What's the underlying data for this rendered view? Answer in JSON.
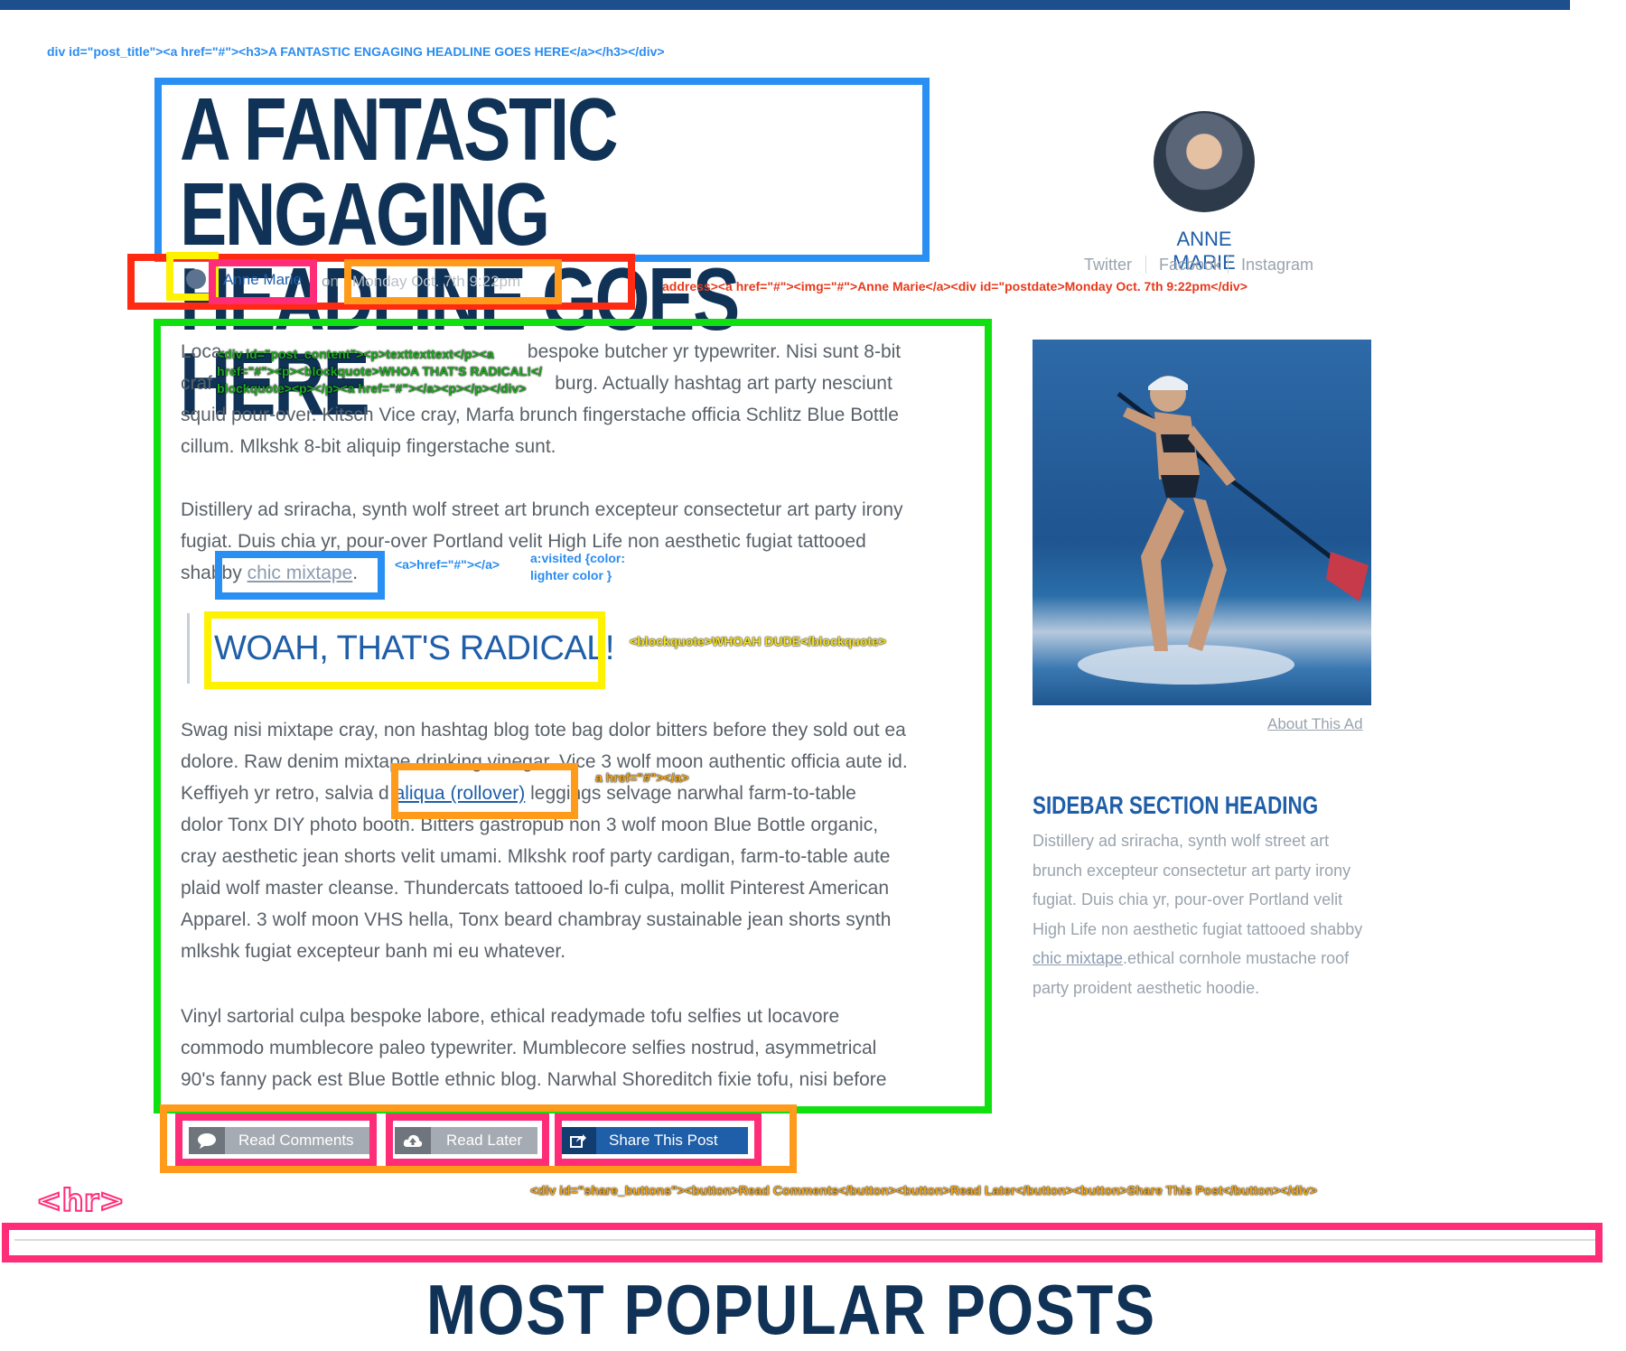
{
  "annotations": {
    "post_title_code": "div id=\"post_title\"><a href=\"#\"><h3>A FANTASTIC ENGAGING HEADLINE GOES HERE</a></h3></div>",
    "address_code": "address><a href=\"#\"><img=\"#\">Anne Marie</a><div id=\"postdate>Monday Oct. 7th 9:22pm</div>",
    "post_content_code_1": "<div id=\"post_content\"><p>texttexttext</p><a",
    "post_content_code_2": "href=\"#\"><p><blockquote>WHOA THAT'S RADICAL!</",
    "post_content_code_3": "blockquote><p></p><a href=\"#\"></a><p></p></div>",
    "anchor_code": "<a>href=\"#\"></a>",
    "visited_code_1": "a:visited {color:",
    "visited_code_2": "lighter color }",
    "blockquote_code": "<blockquote>WHOAH DUDE</blockquote>",
    "rollover_code": "a href=\"#\"></a>",
    "hr_label": "<hr>",
    "share_buttons_code": "<div id=\"share_buttons\"><button>Read Comments</button><button>Read Later</button><button>Share This Post</button></div>"
  },
  "post": {
    "headline_line1": "A FANTASTIC ENGAGING",
    "headline_line2": "HEADLINE GOES HERE",
    "author": "Anne Marie",
    "on": "on",
    "date": "Monday Oct. 7th 9:22pm",
    "p1_l1": "Loca                                                          bespoke butcher yr typewriter. Nisi sunt 8-bit",
    "p1_l2": "craf                                                                 burg. Actually hashtag art party nesciunt",
    "p1_l3": "squid pour-over. Kitsch Vice cray, Marfa brunch fingerstache officia Schlitz Blue Bottle",
    "p1_l4": "cillum. Mlkshk 8-bit aliquip fingerstache sunt.",
    "p2_l1": "Distillery ad sriracha, synth wolf street art brunch excepteur consectetur art party irony",
    "p2_l2": "fugiat. Duis chia yr, pour-over Portland velit High Life non aesthetic fugiat tattooed",
    "p2_pre": "shabby ",
    "p2_link": "chic mixtape",
    "p2_post": ".",
    "blockquote": "WOAH, THAT'S RADICAL!",
    "p3_l1": "Swag nisi mixtape cray, non hashtag blog tote bag dolor bitters before they sold out ea",
    "p3_l2": "dolore. Raw denim mixtape drinking vinegar, Vice 3 wolf moon authentic officia aute id.",
    "p3_pre": "Keffiyeh yr retro, salvia d ",
    "p3_link": "aliqua (rollover)",
    "p3_post": " leggings selvage narwhal farm-to-table",
    "p3_l4": "dolor Tonx DIY photo booth. Bitters gastropub non 3 wolf moon Blue Bottle organic,",
    "p3_l5": "cray aesthetic jean shorts velit umami. Mlkshk roof party cardigan, farm-to-table aute",
    "p3_l6": "plaid wolf master cleanse. Thundercats tattooed lo-fi culpa, mollit Pinterest American",
    "p3_l7": "Apparel. 3 wolf moon VHS hella, Tonx beard chambray sustainable jean shorts synth",
    "p3_l8": "mlkshk fugiat excepteur banh mi eu whatever.",
    "p4_l1": "Vinyl sartorial culpa bespoke labore, ethical readymade tofu selfies ut locavore",
    "p4_l2": "commodo mumblecore paleo typewriter. Mumblecore selfies nostrud, asymmetrical",
    "p4_l3": "90's fanny pack est Blue Bottle ethnic blog. Narwhal Shoreditch fixie tofu, nisi before"
  },
  "sidebar": {
    "author_name": "ANNE MARIE",
    "social": [
      "Twitter",
      "Facbook",
      "Instagram"
    ],
    "about_ad": "About This Ad",
    "section_heading": "SIDEBAR SECTION HEADING",
    "section_text_pre": "Distillery ad sriracha, synth wolf street art brunch excepteur consectetur art party irony fugiat. Duis chia yr, pour-over Portland velit High Life non aesthetic fugiat tattooed shabby ",
    "section_link": "chic mixtape",
    "section_text_post": ".ethical cornhole mustache roof party proident aesthetic hoodie."
  },
  "buttons": {
    "read_comments": "Read Comments",
    "read_later": "Read Later",
    "share": "Share This Post",
    "icons": [
      "speech-bubble-icon",
      "cloud-upload-icon",
      "share-icon"
    ]
  },
  "footer": {
    "popular_heading": "MOST POPULAR POSTS"
  },
  "colors": {
    "navy": "#0f3256",
    "accent_blue": "#1f5ea8",
    "body_grey": "#5a6169",
    "annotation_blue": "#2a8cf0",
    "annotation_red": "#ff2a12",
    "annotation_green": "#10e010",
    "annotation_yellow": "#fff200",
    "annotation_orange": "#ff9a1a",
    "annotation_pink": "#ff2d78"
  }
}
